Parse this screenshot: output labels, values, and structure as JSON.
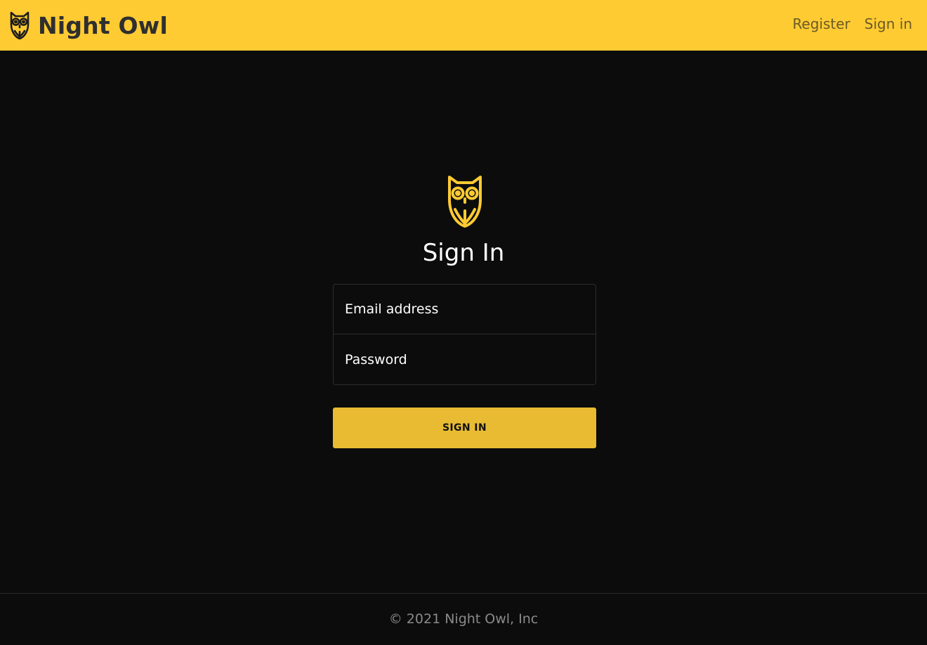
{
  "navbar": {
    "brand_name": "Night Owl",
    "brand_icon": "owl-icon",
    "links": [
      {
        "label": "Register"
      },
      {
        "label": "Sign in"
      }
    ],
    "colors": {
      "background": "#ffcb33",
      "brand_text": "#2f2f2f",
      "link_text": "#6b5a25"
    }
  },
  "main": {
    "logo_icon": "owl-icon",
    "title": "Sign In",
    "form": {
      "email": {
        "placeholder": "Email address",
        "value": ""
      },
      "password": {
        "placeholder": "Password",
        "value": ""
      },
      "submit_label": "SIGN IN"
    },
    "colors": {
      "background": "#0c0c0c",
      "accent": "#ffcb33",
      "button": "#e8bb32"
    }
  },
  "footer": {
    "text": "© 2021 Night Owl, Inc"
  }
}
